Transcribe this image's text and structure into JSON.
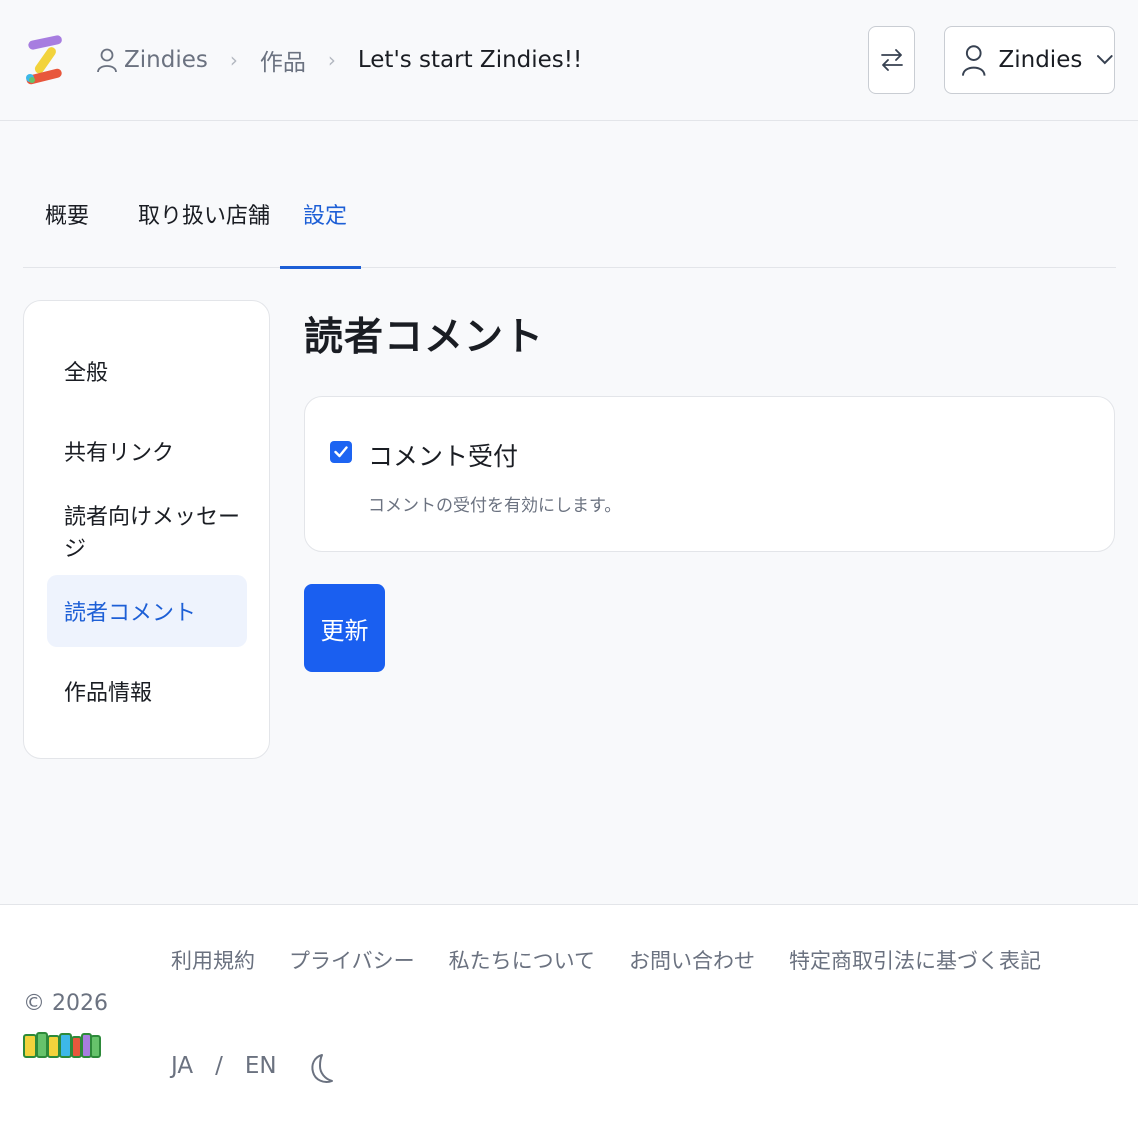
{
  "header": {
    "breadcrumb": [
      {
        "label": "Zindies"
      },
      {
        "label": "作品"
      },
      {
        "label": "Let's start Zindies!!"
      }
    ],
    "account_name": "Zindies"
  },
  "tabs": [
    {
      "label": "概要"
    },
    {
      "label": "取り扱い店舗"
    },
    {
      "label": "設定",
      "active": true
    }
  ],
  "side_menu": [
    {
      "label": "全般"
    },
    {
      "label": "共有リンク"
    },
    {
      "label": "読者向けメッセージ"
    },
    {
      "label": "読者コメント",
      "active": true
    },
    {
      "label": "作品情報"
    }
  ],
  "main": {
    "title": "読者コメント",
    "setting": {
      "label": "コメント受付",
      "description": "コメントの受付を有効にします。",
      "checked": true
    },
    "update_button": "更新"
  },
  "footer": {
    "copyright": "© 2026",
    "links": [
      "利用規約",
      "プライバシー",
      "私たちについて",
      "お問い合わせ",
      "特定商取引法に基づく表記"
    ],
    "lang_ja": "JA",
    "lang_sep": "/",
    "lang_en": "EN"
  },
  "colors": {
    "accent": "#1d5fd6",
    "button": "#1a5ff0",
    "active_bg": "#eef3fd"
  }
}
